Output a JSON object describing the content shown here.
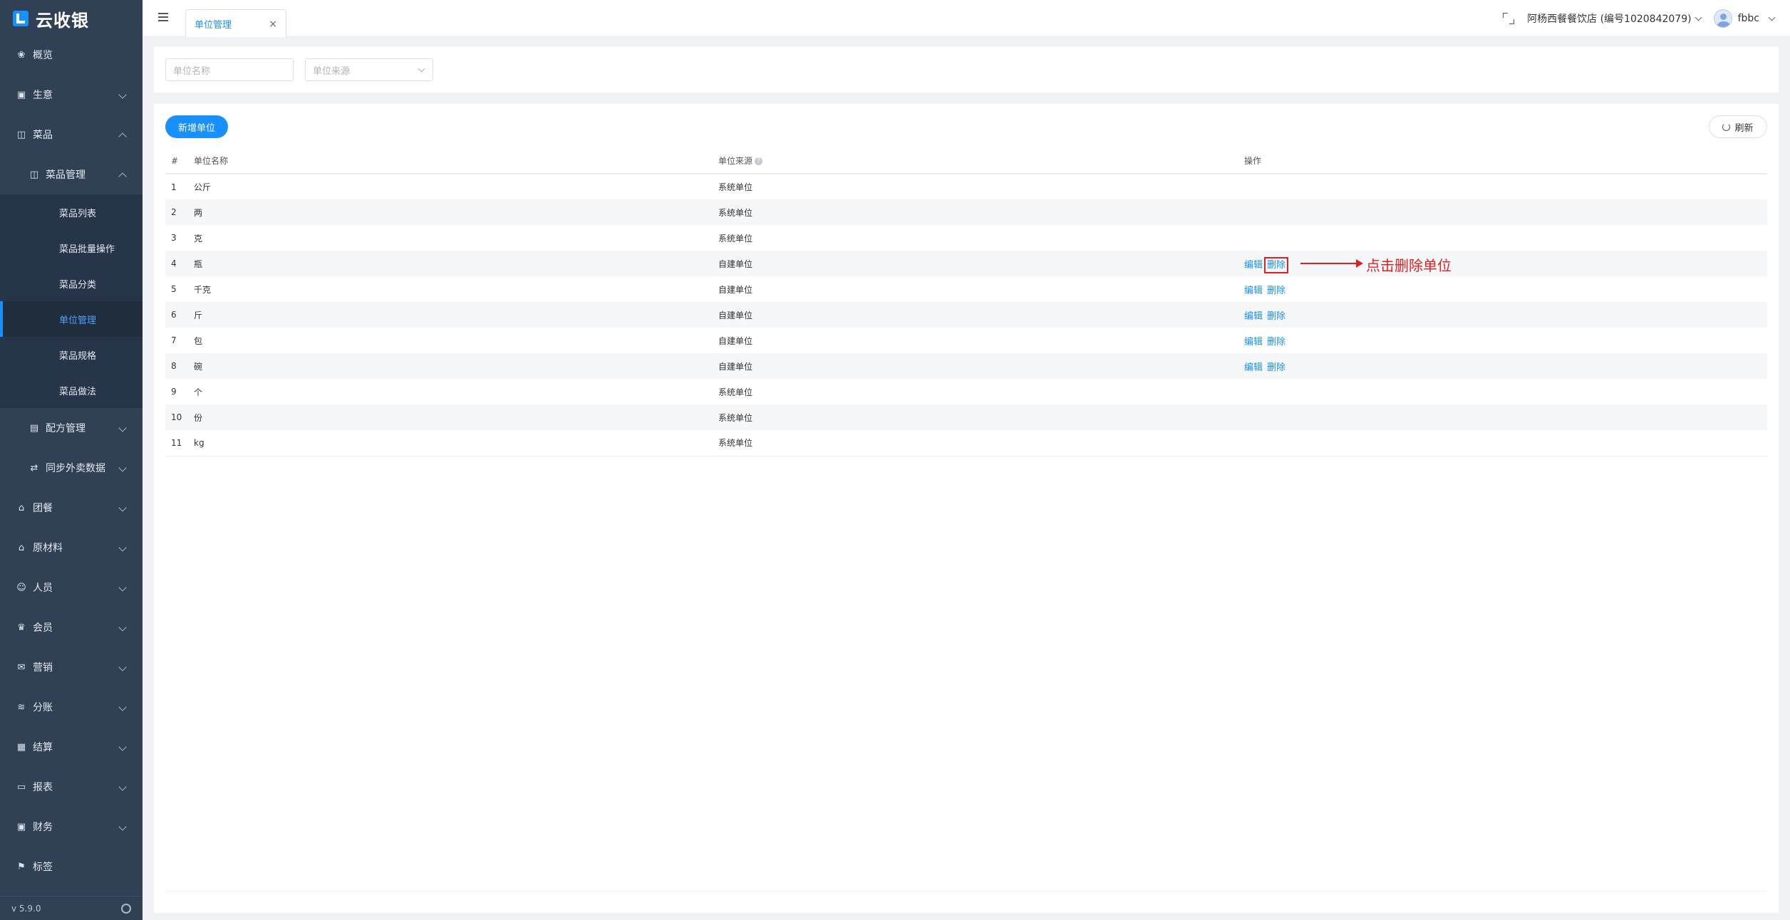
{
  "brand": {
    "name": "云收银"
  },
  "sidebar": {
    "items": [
      {
        "label": "概览",
        "icon": "overview-icon"
      },
      {
        "label": "生意",
        "icon": "business-icon"
      },
      {
        "label": "菜品",
        "icon": "dish-icon"
      },
      {
        "label": "菜品管理",
        "icon": "dish-manage-icon"
      },
      {
        "label": "菜品列表"
      },
      {
        "label": "菜品批量操作"
      },
      {
        "label": "菜品分类"
      },
      {
        "label": "单位管理"
      },
      {
        "label": "菜品规格"
      },
      {
        "label": "菜品做法"
      },
      {
        "label": "配方管理",
        "icon": "recipe-icon"
      },
      {
        "label": "同步外卖数据",
        "icon": "sync-icon"
      },
      {
        "label": "团餐",
        "icon": "group-meal-icon"
      },
      {
        "label": "原材料",
        "icon": "material-icon"
      },
      {
        "label": "人员",
        "icon": "staff-icon"
      },
      {
        "label": "会员",
        "icon": "member-icon"
      },
      {
        "label": "营销",
        "icon": "marketing-icon"
      },
      {
        "label": "分账",
        "icon": "split-icon"
      },
      {
        "label": "结算",
        "icon": "settle-icon"
      },
      {
        "label": "报表",
        "icon": "report-icon"
      },
      {
        "label": "财务",
        "icon": "finance-icon"
      },
      {
        "label": "标签",
        "icon": "tag-icon"
      }
    ],
    "version": "v 5.9.0"
  },
  "header": {
    "tab_label": "单位管理",
    "store": "阿杨西餐餐饮店 (编号1020842079)",
    "user": "fbbc"
  },
  "filters": {
    "name_placeholder": "单位名称",
    "source_placeholder": "单位来源"
  },
  "toolbar": {
    "add_label": "新增单位",
    "refresh_label": "刷新"
  },
  "table": {
    "headers": {
      "index": "#",
      "name": "单位名称",
      "source": "单位来源",
      "actions": "操作"
    },
    "edit_label": "编辑",
    "delete_label": "删除",
    "rows": [
      {
        "index": "1",
        "name": "公斤",
        "source": "系统单位"
      },
      {
        "index": "2",
        "name": "两",
        "source": "系统单位"
      },
      {
        "index": "3",
        "name": "克",
        "source": "系统单位"
      },
      {
        "index": "4",
        "name": "瓶",
        "source": "自建单位"
      },
      {
        "index": "5",
        "name": "千克",
        "source": "自建单位"
      },
      {
        "index": "6",
        "name": "斤",
        "source": "自建单位"
      },
      {
        "index": "7",
        "name": "包",
        "source": "自建单位"
      },
      {
        "index": "8",
        "name": "碗",
        "source": "自建单位"
      },
      {
        "index": "9",
        "name": "个",
        "source": "系统单位"
      },
      {
        "index": "10",
        "name": "份",
        "source": "系统单位"
      },
      {
        "index": "11",
        "name": "kg",
        "source": "系统单位"
      }
    ]
  },
  "annotation": {
    "text": "点击删除单位",
    "color": "#e02020"
  },
  "colors": {
    "accent": "#1890ff",
    "sidebar_bg": "#304156"
  }
}
